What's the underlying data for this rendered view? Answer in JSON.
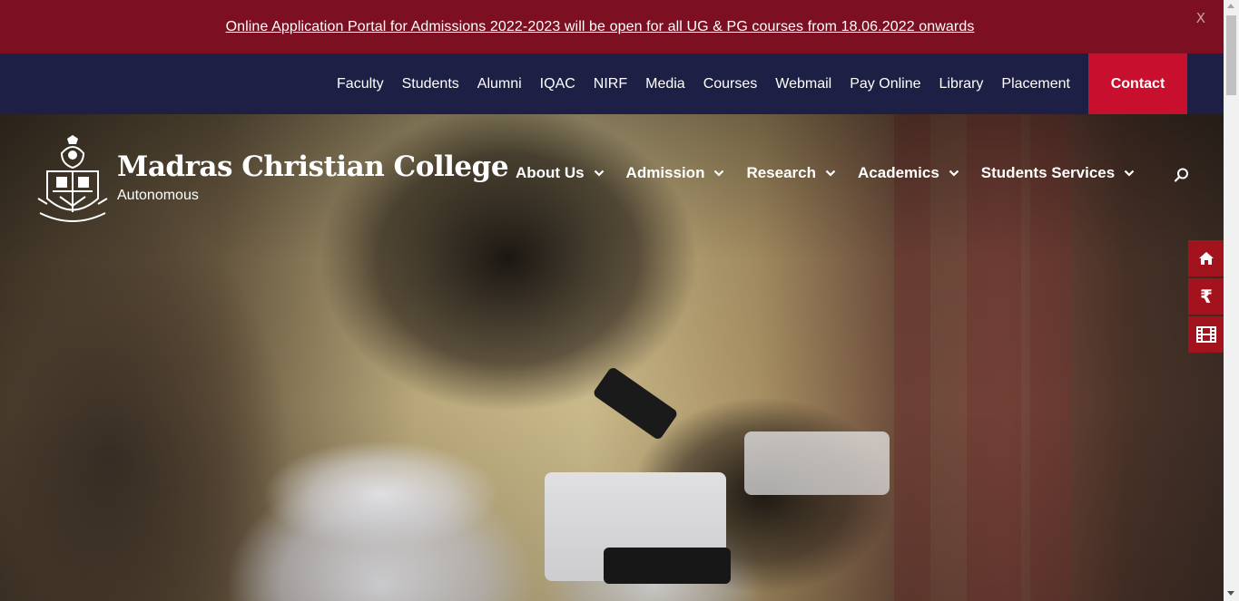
{
  "announcement": {
    "text": "Online Application Portal for Admissions 2022-2023 will be open for all UG & PG courses from 18.06.2022 onwards",
    "close_label": "X"
  },
  "top_nav": {
    "links": [
      "Faculty",
      "Students",
      "Alumni",
      "IQAC",
      "NIRF",
      "Media",
      "Courses",
      "Webmail",
      "Pay Online",
      "Library",
      "Placement"
    ],
    "contact_label": "Contact"
  },
  "brand": {
    "title": "Madras Christian College",
    "subtitle": "Autonomous"
  },
  "main_nav": {
    "items": [
      "About Us",
      "Admission",
      "Research",
      "Academics",
      "Students Services"
    ]
  },
  "quick_links": {
    "icons": [
      "home-icon",
      "rupee-icon",
      "film-icon"
    ],
    "rupee_symbol": "₹"
  },
  "colors": {
    "announcement_bg": "#7d0f22",
    "top_nav_bg": "#1e1f44",
    "contact_bg": "#c8102e",
    "quick_link_bg": "#a3131d"
  }
}
